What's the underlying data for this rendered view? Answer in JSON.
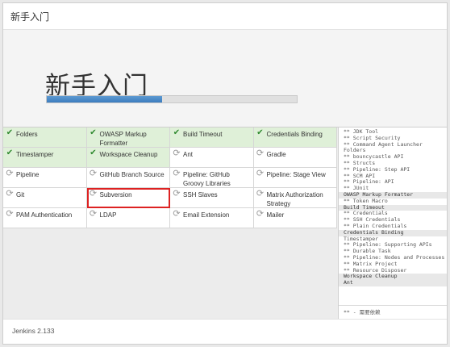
{
  "header": {
    "title": "新手入门"
  },
  "hero": {
    "heading": "新手入门",
    "progress_fraction": 0.46
  },
  "plugins": [
    {
      "label": "Folders",
      "status": "done",
      "icon": "check-icon"
    },
    {
      "label": "OWASP Markup Formatter",
      "status": "done",
      "icon": "check-icon"
    },
    {
      "label": "Build Timeout",
      "status": "done",
      "icon": "check-icon"
    },
    {
      "label": "Credentials Binding",
      "status": "done",
      "icon": "check-icon"
    },
    {
      "label": "Timestamper",
      "status": "done",
      "icon": "check-icon"
    },
    {
      "label": "Workspace Cleanup",
      "status": "done",
      "icon": "check-icon"
    },
    {
      "label": "Ant",
      "status": "pending",
      "icon": "refresh-icon"
    },
    {
      "label": "Gradle",
      "status": "pending",
      "icon": "refresh-icon"
    },
    {
      "label": "Pipeline",
      "status": "pending",
      "icon": "refresh-icon"
    },
    {
      "label": "GitHub Branch Source",
      "status": "pending",
      "icon": "refresh-icon"
    },
    {
      "label": "Pipeline: GitHub Groovy Libraries",
      "status": "pending",
      "icon": "refresh-icon"
    },
    {
      "label": "Pipeline: Stage View",
      "status": "pending",
      "icon": "refresh-icon"
    },
    {
      "label": "Git",
      "status": "pending",
      "icon": "refresh-icon"
    },
    {
      "label": "Subversion",
      "status": "pending",
      "icon": "refresh-icon",
      "highlighted": true
    },
    {
      "label": "SSH Slaves",
      "status": "pending",
      "icon": "refresh-icon"
    },
    {
      "label": "Matrix Authorization Strategy",
      "status": "pending",
      "icon": "refresh-icon"
    },
    {
      "label": "PAM Authentication",
      "status": "pending",
      "icon": "refresh-icon"
    },
    {
      "label": "LDAP",
      "status": "pending",
      "icon": "refresh-icon"
    },
    {
      "label": "Email Extension",
      "status": "pending",
      "icon": "refresh-icon"
    },
    {
      "label": "Mailer",
      "status": "pending",
      "icon": "refresh-icon"
    }
  ],
  "log": {
    "lines": [
      {
        "text": "** JDK Tool",
        "head": false
      },
      {
        "text": "** Script Security",
        "head": false
      },
      {
        "text": "** Command Agent Launcher",
        "head": false
      },
      {
        "text": "Folders",
        "head": false
      },
      {
        "text": "** bouncycastle API",
        "head": false
      },
      {
        "text": "** Structs",
        "head": false
      },
      {
        "text": "** Pipeline: Step API",
        "head": false
      },
      {
        "text": "** SCM API",
        "head": false
      },
      {
        "text": "** Pipeline: API",
        "head": false
      },
      {
        "text": "** JUnit",
        "head": false
      },
      {
        "text": "OWASP Markup Formatter",
        "head": true
      },
      {
        "text": "** Token Macro",
        "head": false
      },
      {
        "text": "Build Timeout",
        "head": true
      },
      {
        "text": "** Credentials",
        "head": false
      },
      {
        "text": "** SSH Credentials",
        "head": false
      },
      {
        "text": "** Plain Credentials",
        "head": false
      },
      {
        "text": "Credentials Binding",
        "head": true
      },
      {
        "text": "Timestamper",
        "head": false
      },
      {
        "text": "** Pipeline: Supporting APIs",
        "head": false
      },
      {
        "text": "** Durable Task",
        "head": false
      },
      {
        "text": "** Pipeline: Nodes and Processes",
        "head": false
      },
      {
        "text": "** Matrix Project",
        "head": false
      },
      {
        "text": "** Resource Disposer",
        "head": false
      },
      {
        "text": "Workspace Cleanup",
        "head": true
      },
      {
        "text": "Ant",
        "head": true
      }
    ],
    "footnote": "** - 需要依赖"
  },
  "footer": {
    "version": "Jenkins 2.133"
  },
  "colors": {
    "done_bg": "#dff0d8",
    "check": "#2f8a2f",
    "progress": "#3c7cbf",
    "highlight": "#dd2222"
  }
}
